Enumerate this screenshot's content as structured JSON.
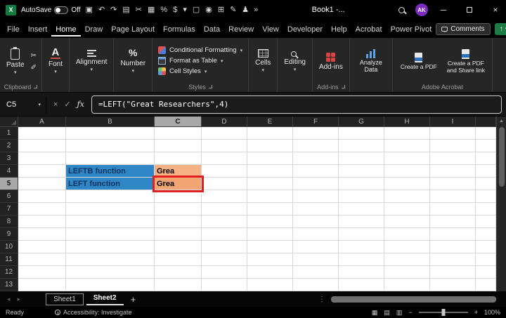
{
  "window": {
    "app_logo": "X",
    "autosave_label": "AutoSave",
    "autosave_state": "Off",
    "title": "Book1 -...",
    "avatar_initials": "AK",
    "overflow_glyph": "»",
    "qat_icons": [
      {
        "name": "save-icon",
        "glyph": "▣"
      },
      {
        "name": "undo-icon",
        "glyph": "↶"
      },
      {
        "name": "redo-icon",
        "glyph": "↷"
      },
      {
        "name": "clipboard-icon",
        "glyph": "▤"
      },
      {
        "name": "cut-icon",
        "glyph": "✂"
      },
      {
        "name": "notebook-icon",
        "glyph": "▦"
      },
      {
        "name": "percent-icon",
        "glyph": "%"
      },
      {
        "name": "currency-icon",
        "glyph": "$"
      },
      {
        "name": "chevron-down-icon",
        "glyph": "▾"
      },
      {
        "name": "document-icon",
        "glyph": "▢"
      },
      {
        "name": "camera-icon",
        "glyph": "◉"
      },
      {
        "name": "borders-icon",
        "glyph": "⊞"
      },
      {
        "name": "draw-icon",
        "glyph": "✎"
      },
      {
        "name": "add-person-icon",
        "glyph": "♟"
      }
    ]
  },
  "menubar": {
    "tabs": [
      "File",
      "Insert",
      "Home",
      "Draw",
      "Page Layout",
      "Formulas",
      "Data",
      "Review",
      "View",
      "Developer",
      "Help",
      "Acrobat",
      "Power Pivot"
    ],
    "active_tab": "Home",
    "comments": "Comments"
  },
  "ribbon": {
    "paste": "Paste",
    "font": "Font",
    "alignment": "Alignment",
    "number": "Number",
    "conditional_formatting": "Conditional Formatting",
    "format_as_table": "Format as Table",
    "cell_styles": "Cell Styles",
    "cells": "Cells",
    "editing": "Editing",
    "addins_button": "Add-ins",
    "analyze_data": "Analyze Data",
    "create_pdf": "Create a PDF",
    "create_pdf_share": "Create a PDF and Share link",
    "group_clipboard": "Clipboard",
    "group_styles": "Styles",
    "group_addins": "Add-ins",
    "group_acrobat": "Adobe Acrobat"
  },
  "formula_bar": {
    "name_box": "C5",
    "fx": "ƒx",
    "cancel": "×",
    "enter": "✓",
    "formula": "=LEFT(\"Great Researchers\",4)"
  },
  "grid": {
    "column_headers": [
      "A",
      "B",
      "C",
      "D",
      "E",
      "F",
      "G",
      "H",
      "I"
    ],
    "row_count": 13,
    "selected_column": "C",
    "selected_row": 5,
    "active_cell": "C5",
    "annotation_color": "#E02020",
    "cells": [
      {
        "col": "B",
        "row": 4,
        "text": "LEFTB function",
        "fill": "#2E86C6",
        "color": "#12325C",
        "bold": true
      },
      {
        "col": "C",
        "row": 4,
        "text": "Grea",
        "fill": "#F4B183",
        "color": "#000000",
        "bold": true
      },
      {
        "col": "B",
        "row": 5,
        "text": "LEFT function",
        "fill": "#2E86C6",
        "color": "#12325C",
        "bold": true
      },
      {
        "col": "C",
        "row": 5,
        "text": "Grea",
        "fill": "#F2A572",
        "color": "#000000",
        "bold": true,
        "annotated": true
      }
    ]
  },
  "sheet_tabs": {
    "tabs": [
      "Sheet1",
      "Sheet2"
    ],
    "active": "Sheet2",
    "add_label": "+"
  },
  "status_bar": {
    "mode": "Ready",
    "accessibility": "Accessibility: Investigate",
    "zoom": "100%"
  }
}
